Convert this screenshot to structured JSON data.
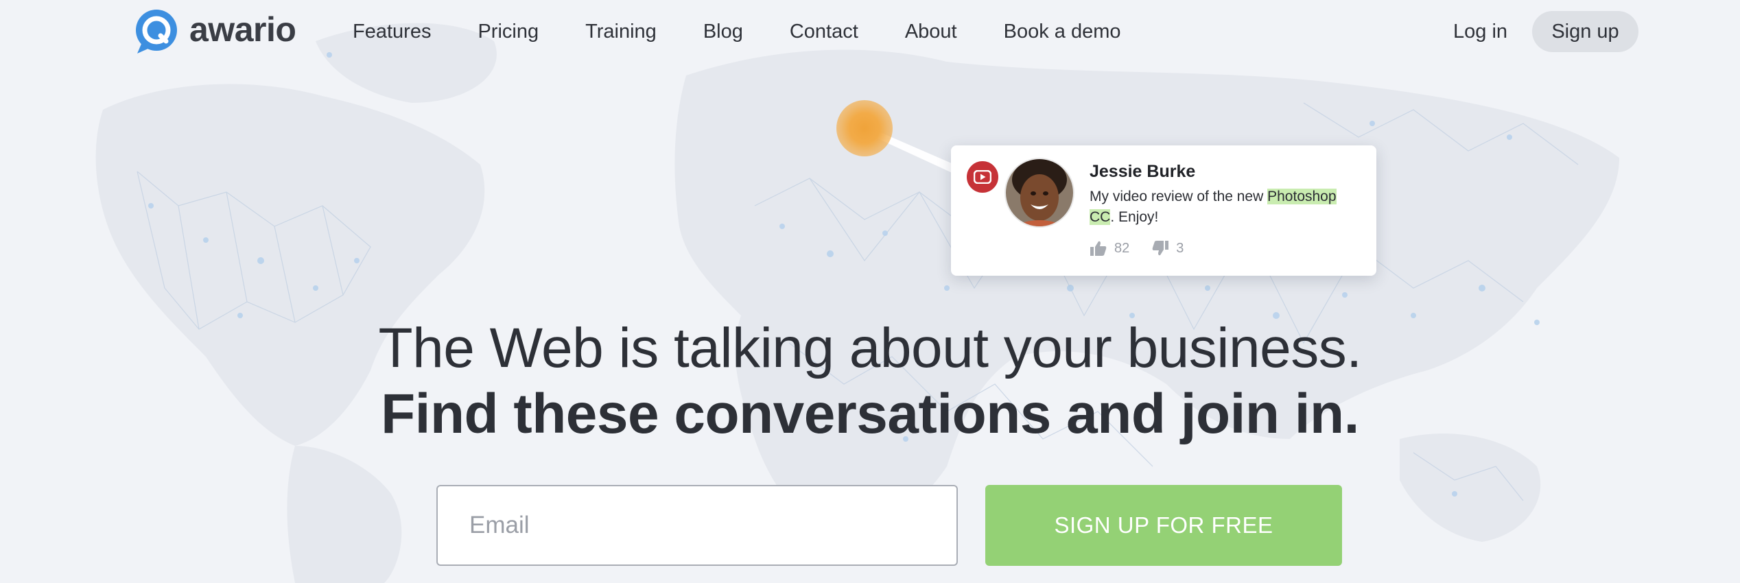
{
  "header": {
    "logo_text": "awario",
    "nav": [
      "Features",
      "Pricing",
      "Training",
      "Blog",
      "Contact",
      "About",
      "Book a demo"
    ],
    "login_label": "Log in",
    "signup_label": "Sign up"
  },
  "mention": {
    "source_icon": "youtube-icon",
    "author": "Jessie Burke",
    "text_before": "My video review of the new ",
    "highlight": "Photoshop CC",
    "text_after": ". Enjoy!",
    "likes": "82",
    "dislikes": "3"
  },
  "hero": {
    "line1": "The Web is talking about your business.",
    "line2": "Find these conversations and join in.",
    "email_placeholder": "Email",
    "cta_label": "SIGN UP FOR FREE"
  },
  "colors": {
    "background": "#f1f3f7",
    "logo_blue": "#3d8fe0",
    "cta_green": "#94d175",
    "youtube_red": "#c63237",
    "pin_orange": "#f0a33a",
    "highlight_green": "#c9ecb0"
  }
}
